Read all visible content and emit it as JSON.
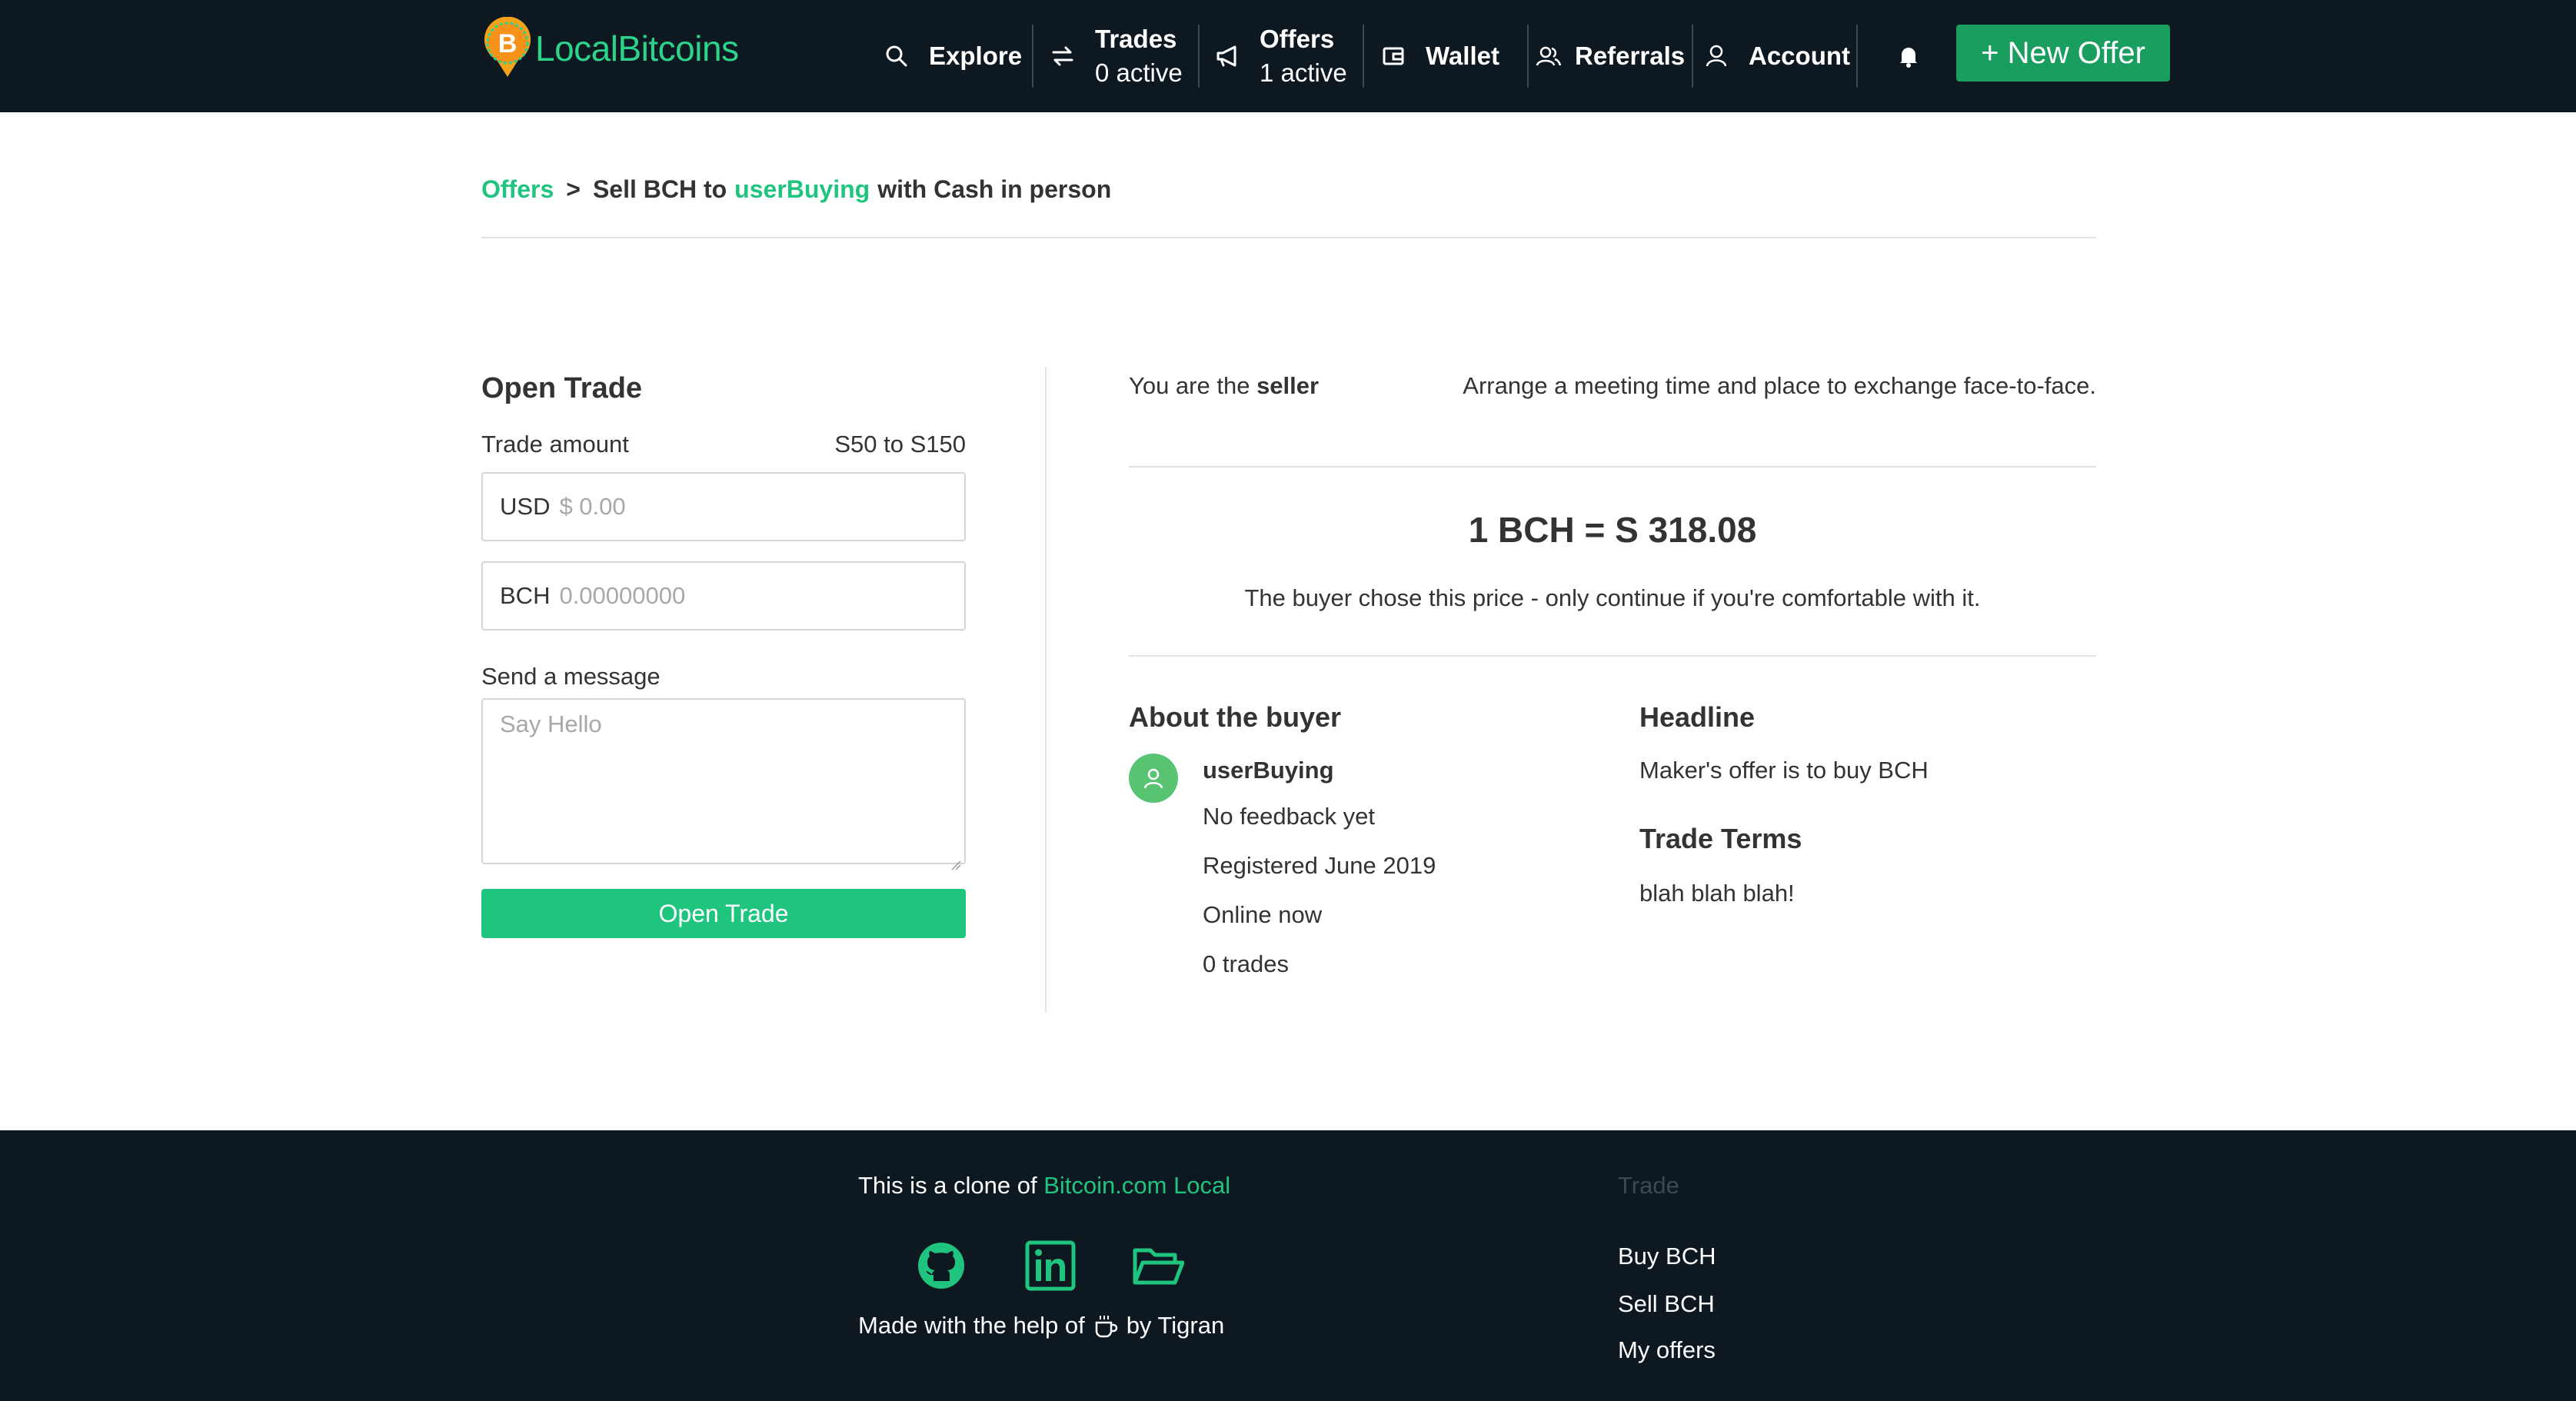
{
  "header": {
    "logo_text": "LocalBitcoins",
    "nav": {
      "explore": "Explore",
      "trades_label": "Trades",
      "trades_sub": "0 active",
      "offers_label": "Offers",
      "offers_sub": "1 active",
      "wallet": "Wallet",
      "referrals": "Referrals",
      "account": "Account"
    },
    "new_offer": "+ New Offer"
  },
  "breadcrumb": {
    "root": "Offers",
    "separator": ">",
    "prefix": "Sell BCH to",
    "user": "userBuying",
    "suffix": "with Cash in person"
  },
  "trade_form": {
    "title": "Open Trade",
    "amount_label": "Trade amount",
    "amount_range": "S50 to S150",
    "usd_currency": "USD",
    "usd_placeholder": "$ 0.00",
    "bch_currency": "BCH",
    "bch_placeholder": "0.00000000",
    "message_label": "Send a message",
    "message_placeholder": "Say Hello",
    "submit": "Open Trade"
  },
  "info": {
    "role_prefix": "You are the",
    "role": "seller",
    "instruction": "Arrange a meeting time and place to exchange face-to-face.",
    "rate": "1 BCH = S 318.08",
    "rate_note": "The buyer chose this price - only continue if you're comfortable with it."
  },
  "buyer": {
    "heading": "About the buyer",
    "name": "userBuying",
    "feedback": "No feedback yet",
    "registered": "Registered June 2019",
    "status": "Online now",
    "trades": "0 trades"
  },
  "offer": {
    "headline_heading": "Headline",
    "headline": "Maker's offer is to buy BCH",
    "terms_heading": "Trade Terms",
    "terms": "blah blah blah!"
  },
  "footer": {
    "clone_prefix": "This is a clone of",
    "clone_link": "Bitcoin.com Local",
    "made_prefix": "Made with the help of",
    "made_suffix": "by Tigran",
    "trade_heading": "Trade",
    "links": [
      "Buy BCH",
      "Sell BCH",
      "My offers"
    ]
  },
  "colors": {
    "header_bg": "#0d1821",
    "accent": "#1fc47f",
    "new_offer_bg": "#1a9e5f",
    "avatar": "#58c472"
  },
  "icons": {
    "logo": "bitcoin-pin-icon",
    "explore": "search-icon",
    "trades": "swap-icon",
    "offers": "megaphone-icon",
    "wallet": "wallet-icon",
    "referrals": "users-icon",
    "account": "user-icon",
    "notifications": "bell-icon",
    "social": [
      "github-icon",
      "linkedin-icon",
      "folder-icon"
    ],
    "coffee": "coffee-icon"
  }
}
